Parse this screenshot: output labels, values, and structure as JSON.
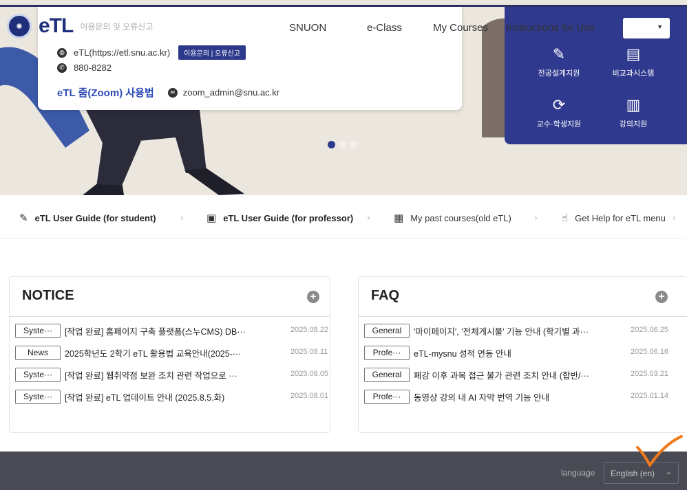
{
  "header": {
    "logo_text": "eTL",
    "logo_sub": "이용문의 및 오류신고",
    "nav": [
      "SNUON",
      "e-Class",
      "My Courses",
      "Instructions for Use"
    ],
    "select_value": ""
  },
  "hero": {
    "site_line": "eTL(https://etl.snu.ac.kr)",
    "contact_tag": "이용문의 | 오류신고",
    "phone": "880-8282",
    "zoom_guide": "eTL 줌(Zoom) 사용법",
    "zoom_email": "zoom_admin@snu.ac.kr",
    "carousel": {
      "count": 3,
      "active": 0
    },
    "quick_links": [
      {
        "label": "전공설계지원",
        "icon": "pencil-user-icon"
      },
      {
        "label": "비교과시스템",
        "icon": "document-search-icon"
      },
      {
        "label": "교수·학생지원",
        "icon": "support-icon"
      },
      {
        "label": "강의지원",
        "icon": "book-icon"
      }
    ]
  },
  "guides": [
    {
      "label": "eTL User Guide (for student)",
      "icon": "edit-note-icon"
    },
    {
      "label": "eTL User Guide (for professor)",
      "icon": "presentation-icon"
    },
    {
      "label": "My past courses(old eTL)",
      "icon": "calendar-icon"
    },
    {
      "label": "Get Help for eTL menu",
      "icon": "help-hand-icon"
    }
  ],
  "notice": {
    "title": "NOTICE",
    "rows": [
      {
        "badge": "Syste···",
        "title": "[작업 완료] 홈페이지 구축 플랫폼(스누CMS) DB···",
        "date": "2025.08.22"
      },
      {
        "badge": "News",
        "title": "2025학년도 2학기 eTL 활용법 교육안내(2025-···",
        "date": "2025.08.11"
      },
      {
        "badge": "Syste···",
        "title": "[작업 완료] 웹취약점 보완 조치 관련 작업으로 ···",
        "date": "2025.08.05"
      },
      {
        "badge": "Syste···",
        "title": "[작업 완료] eTL 업데이트 안내 (2025.8.5.화)",
        "date": "2025.08.01"
      }
    ]
  },
  "faq": {
    "title": "FAQ",
    "rows": [
      {
        "badge": "General",
        "title": "'마이페이지', '전체게시물' 기능 안내 (학기별 과···",
        "date": "2025.06.25"
      },
      {
        "badge": "Profe···",
        "title": "eTL-mysnu 성적 연동 안내",
        "date": "2025.06.16"
      },
      {
        "badge": "General",
        "title": "폐강 이후 과목 접근 불가 관련 조치 안내 (합반/···",
        "date": "2025.03.21"
      },
      {
        "badge": "Profe···",
        "title": "동영상 강의 내 AI 자막 번역 기능 안내",
        "date": "2025.01.14"
      }
    ]
  },
  "footer": {
    "language_label": "language",
    "language_value": "English (en)"
  },
  "colors": {
    "brand_navy": "#2f3a8e",
    "footer_bg": "#4a4a55",
    "annotation_orange": "#f07a1a"
  }
}
